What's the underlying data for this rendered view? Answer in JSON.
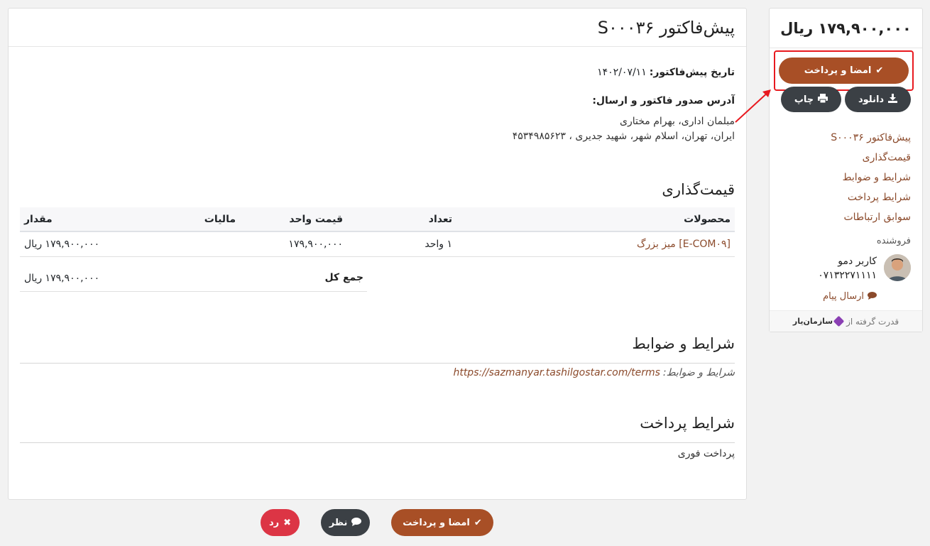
{
  "sidebar": {
    "total": "۱۷۹,۹۰۰,۰۰۰ ریال",
    "sign_pay_label": "امضا و پرداخت",
    "download_label": "دانلود",
    "print_label": "چاپ",
    "nav": [
      "پیش‌فاکتور S۰۰۰۳۶",
      "قیمت‌گذاری",
      "شرایط و ضوابط",
      "شرایط پرداخت",
      "سوابق ارتباطات"
    ],
    "seller_title": "فروشنده",
    "seller_name": "کاربر دمو",
    "seller_phone": "۰۷۱۳۲۲۷۱۱۱۱",
    "send_message": "ارسال پیام",
    "powered_by": "قدرت گرفته از",
    "brand": "سازمان‌یار"
  },
  "main": {
    "title": "پیش‌فاکتور S۰۰۰۳۶",
    "date_label": "تاریخ پیش‌فاکتور:",
    "date_value": "۱۴۰۲/۰۷/۱۱",
    "address_title": "آدرس صدور فاکتور و ارسال:",
    "address_line1": "مبلمان اداری، بهرام مختاری",
    "address_line2": "ایران، تهران، اسلام شهر، شهید جدیری ، ۴۵۳۴۹۸۵۶۲۳",
    "pricing_title": "قیمت‌گذاری",
    "table": {
      "headers": {
        "product": "محصولات",
        "qty": "تعداد",
        "unit_price": "قیمت واحد",
        "tax": "مالیات",
        "amount": "مقدار"
      },
      "rows": [
        {
          "product": "[E-COM۰۹] میز بزرگ",
          "qty": "۱ واحد",
          "unit_price": "۱۷۹,۹۰۰,۰۰۰",
          "tax": "",
          "amount": "۱۷۹,۹۰۰,۰۰۰ ریال"
        }
      ]
    },
    "total_label": "جمع کل",
    "total_value": "۱۷۹,۹۰۰,۰۰۰ ریال",
    "terms_title": "شرایط و ضوابط",
    "terms_label": "شرایط و ضوابط:",
    "terms_link": "https://sazmanyar.tashilgostar.com/terms",
    "payment_title": "شرایط پرداخت",
    "payment_text": "پرداخت فوری"
  },
  "bottom": {
    "sign_pay_label": "امضا و پرداخت",
    "comment_label": "نظر",
    "reject_label": "رد"
  },
  "colors": {
    "accent": "#a84f26",
    "dark_button": "#3b4045",
    "danger": "#dc3545",
    "link": "#8b4a2b",
    "highlight_annotation": "#e8191f"
  }
}
